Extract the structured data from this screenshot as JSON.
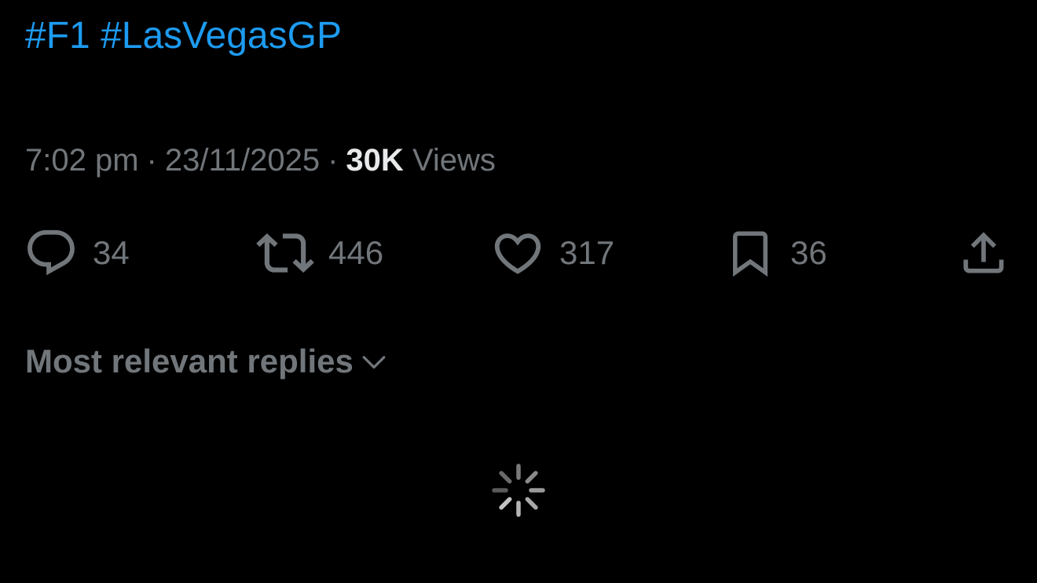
{
  "tweet": {
    "hashtags": [
      "#F1",
      "#LasVegasGP"
    ],
    "time": "7:02 pm",
    "date": "23/11/2025",
    "separator": "·",
    "views_count": "30K",
    "views_label": "Views"
  },
  "actions": {
    "reply_count": "34",
    "repost_count": "446",
    "like_count": "317",
    "bookmark_count": "36"
  },
  "replies": {
    "sort_label": "Most relevant replies"
  },
  "colors": {
    "background": "#000000",
    "link": "#1d9bf0",
    "muted": "#71767b",
    "emphasis": "#e7e9ea"
  },
  "icons": {
    "reply": "reply-icon",
    "repost": "repost-icon",
    "like": "heart-icon",
    "bookmark": "bookmark-icon",
    "share": "share-icon",
    "sort": "chevron-down-icon",
    "loading": "loading-spinner-icon"
  }
}
